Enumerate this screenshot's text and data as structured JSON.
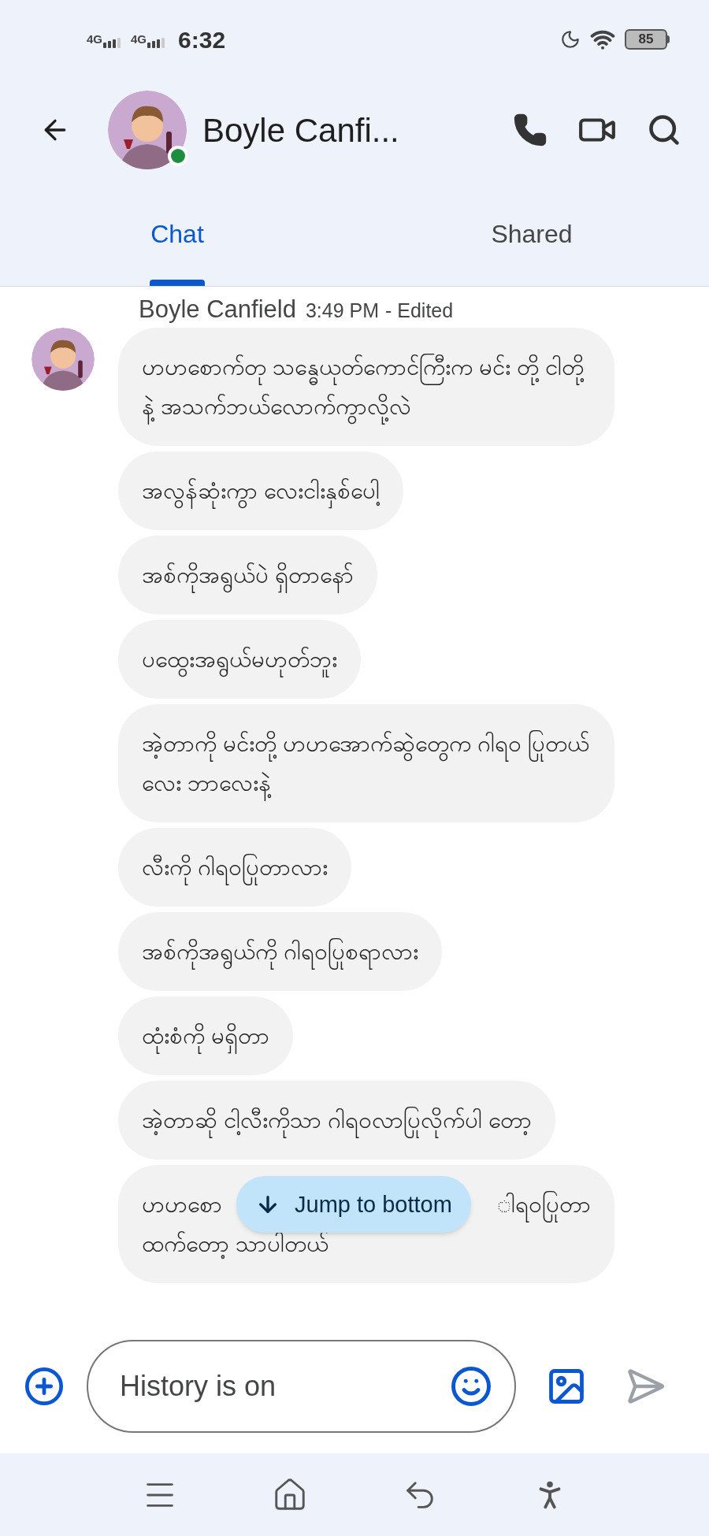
{
  "status_bar": {
    "networks": [
      "4G",
      "4G"
    ],
    "time": "6:32",
    "battery": "85"
  },
  "header": {
    "contact_name": "Boyle Canfi...",
    "online": true
  },
  "tabs": [
    {
      "label": "Chat",
      "selected": true
    },
    {
      "label": "Shared",
      "selected": false
    }
  ],
  "sender": {
    "name": "Boyle Canfield",
    "time": "3:49 PM",
    "edited": "- Edited"
  },
  "messages": [
    {
      "kind": "text",
      "text": "ဟဟစောက်တု သန္ဓေယုတ်ကောင်ကြီးက မင်း တို့ ငါတို့နဲ့ အသက်ဘယ်လောက်ကွာလို့လဲ"
    },
    {
      "kind": "text",
      "text": "အလွန်ဆုံးကွာ လေးငါးနှစ်ပေါ့"
    },
    {
      "kind": "text",
      "text": "အစ်ကိုအရွယ်ပဲ ရှိတာနော်"
    },
    {
      "kind": "text",
      "text": "ပထွေးအရွယ်မဟုတ်ဘူး"
    },
    {
      "kind": "text",
      "text": "အဲ့တာကို မင်းတို့ ဟဟအောက်ဆွဲတွေက ဂါရဝ ပြုတယ်လေး ဘာလေးနဲ့"
    },
    {
      "kind": "text",
      "text": "လီးကို ဂါရဝပြုတာလား"
    },
    {
      "kind": "text",
      "text": "အစ်ကိုအရွယ်ကို ဂါရဝပြုစရာလား"
    },
    {
      "kind": "text",
      "text": "ထုံးစံကို မရှိတာ"
    },
    {
      "kind": "text",
      "text": "အဲ့တာဆို ငါ့လီးကိုသာ ဂါရဝလာပြုလိုက်ပါ တော့"
    },
    {
      "kind": "partial",
      "line_1_start": "ဟဟစော",
      "line_1_end": "ါရဝပြုတာ",
      "line_2": "ထက်တော့ သာပါတယ်"
    }
  ],
  "jump_button": {
    "label": "Jump to bottom"
  },
  "composer": {
    "placeholder": "History is on"
  }
}
